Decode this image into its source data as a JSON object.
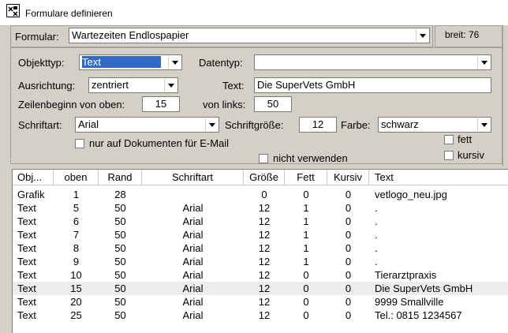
{
  "window": {
    "title": "Formulare definieren"
  },
  "formular": {
    "label": "Formular:",
    "value": "Wartezeiten Endlospapier",
    "breit": "breit: 76"
  },
  "fields": {
    "objekttyp_label": "Objekttyp:",
    "objekttyp_value": "Text",
    "datentyp_label": "Datentyp:",
    "datentyp_value": "",
    "ausrichtung_label": "Ausrichtung:",
    "ausrichtung_value": "zentriert",
    "text_label": "Text:",
    "text_value": "Die SuperVets GmbH",
    "zeilenbeginn_label": "Zeilenbeginn von oben:",
    "zeilenbeginn_value": "15",
    "vonlinks_label": "von links:",
    "vonlinks_value": "50",
    "schriftart_label": "Schriftart:",
    "schriftart_value": "Arial",
    "schriftgroesse_label": "Schriftgröße:",
    "schriftgroesse_value": "12",
    "farbe_label": "Farbe:",
    "farbe_value": "schwarz",
    "email_label": "nur auf Dokumenten für E-Mail",
    "nicht_label": "nicht verwenden",
    "fett_label": "fett",
    "kursiv_label": "kursiv"
  },
  "table": {
    "headers": [
      "Obj...",
      "oben",
      "Rand",
      "Schriftart",
      "Größe",
      "Fett",
      "Kursiv",
      "Text"
    ],
    "rows": [
      [
        "Grafik",
        "1",
        "28",
        "",
        "0",
        "0",
        "0",
        "vetlogo_neu.jpg"
      ],
      [
        "Text",
        "5",
        "50",
        "Arial",
        "12",
        "1",
        "0",
        "."
      ],
      [
        "Text",
        "6",
        "50",
        "Arial",
        "12",
        "1",
        "0",
        "."
      ],
      [
        "Text",
        "7",
        "50",
        "Arial",
        "12",
        "1",
        "0",
        "."
      ],
      [
        "Text",
        "8",
        "50",
        "Arial",
        "12",
        "1",
        "0",
        "."
      ],
      [
        "Text",
        "9",
        "50",
        "Arial",
        "12",
        "1",
        "0",
        "."
      ],
      [
        "Text",
        "10",
        "50",
        "Arial",
        "12",
        "0",
        "0",
        "Tierarztpraxis"
      ],
      [
        "Text",
        "15",
        "50",
        "Arial",
        "12",
        "0",
        "0",
        "Die SuperVets GmbH"
      ],
      [
        "Text",
        "20",
        "50",
        "Arial",
        "12",
        "0",
        "0",
        "9999 Smallville"
      ],
      [
        "Text",
        "25",
        "50",
        "Arial",
        "12",
        "0",
        "0",
        "Tel.: 0815 1234567"
      ]
    ],
    "selected_row": 7
  },
  "colors": {
    "selection": "#316ac5",
    "face": "#d4d0c8"
  }
}
